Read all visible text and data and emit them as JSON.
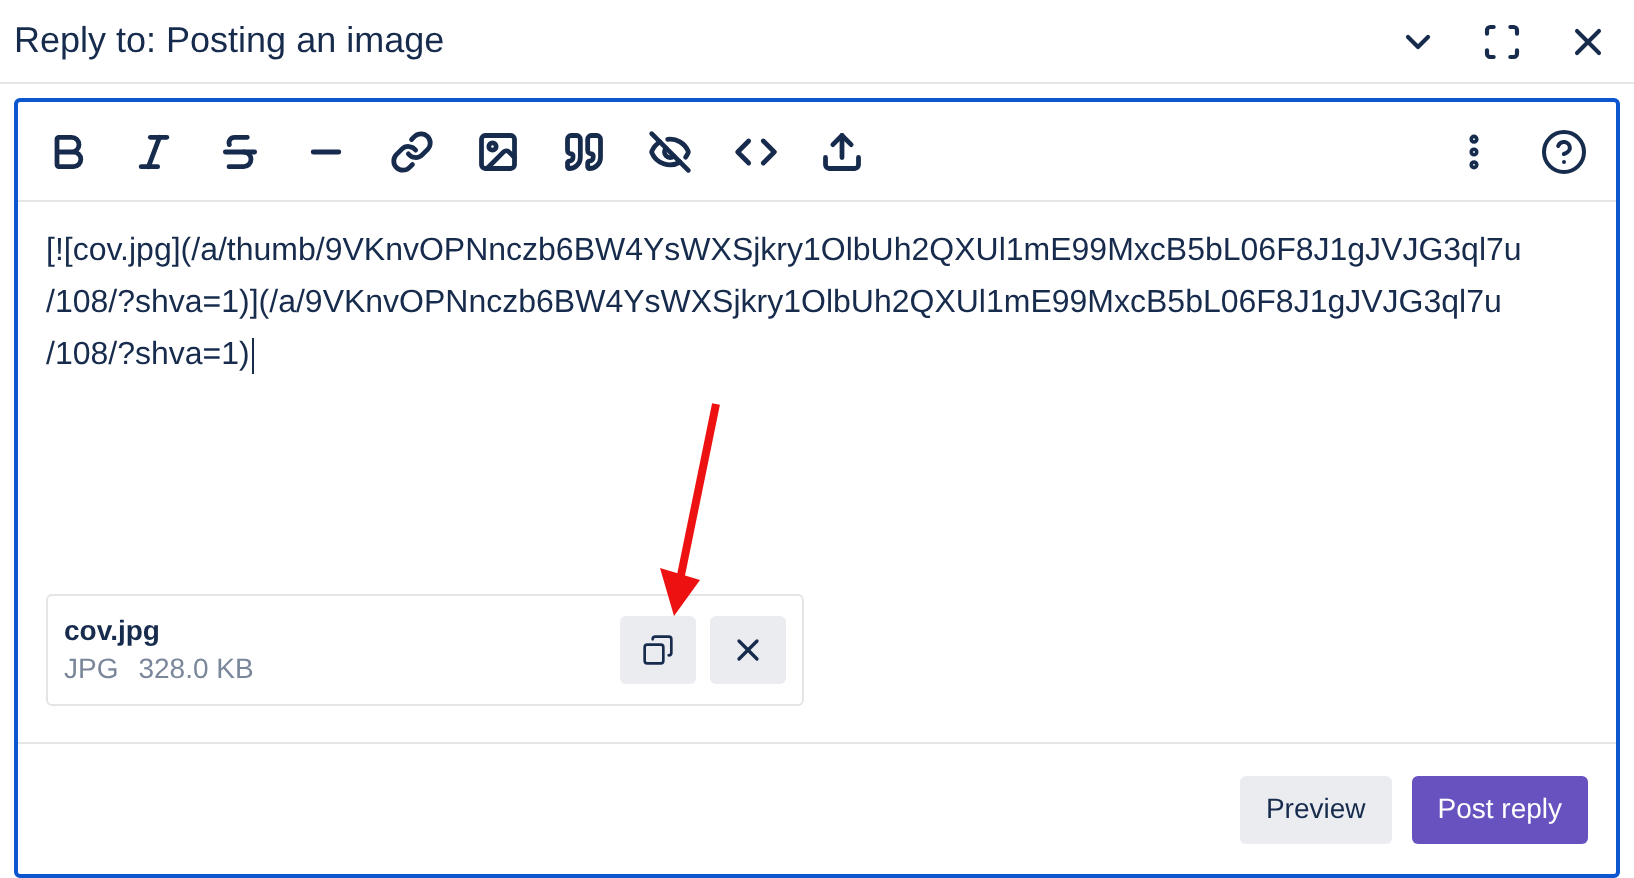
{
  "dialog": {
    "title": "Reply to: Posting an image"
  },
  "editor": {
    "lines": [
      "[![cov.jpg](/a/thumb/9VKnvOPNnczb6BW4YsWXSjkry1OlbUh2QXUl1mE99MxcB5bL06F8J1gJVJG3ql7u",
      "/108/?shva=1)](/a/9VKnvOPNnczb6BW4YsWXSjkry1OlbUh2QXUl1mE99MxcB5bL06F8J1gJVJG3ql7u",
      "/108/?shva=1)"
    ]
  },
  "attachment": {
    "name": "cov.jpg",
    "type": "JPG",
    "size": "328.0 KB"
  },
  "buttons": [
    {
      "label": "Preview",
      "kind": "secondary"
    },
    {
      "label": "Post reply",
      "kind": "primary"
    }
  ]
}
